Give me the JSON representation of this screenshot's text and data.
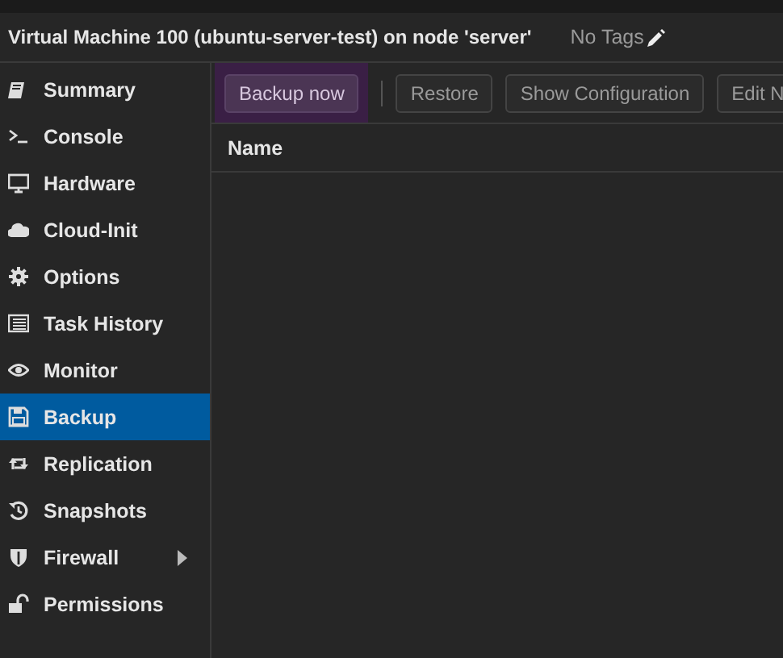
{
  "header": {
    "title": "Virtual Machine 100 (ubuntu-server-test) on node 'server'",
    "tags": "No Tags"
  },
  "sidebar": {
    "items": [
      {
        "label": "Summary",
        "kind": "book",
        "selected": false,
        "expandable": false
      },
      {
        "label": "Console",
        "kind": "terminal",
        "selected": false,
        "expandable": false
      },
      {
        "label": "Hardware",
        "kind": "monitor",
        "selected": false,
        "expandable": false
      },
      {
        "label": "Cloud-Init",
        "kind": "cloud",
        "selected": false,
        "expandable": false
      },
      {
        "label": "Options",
        "kind": "gear",
        "selected": false,
        "expandable": false
      },
      {
        "label": "Task History",
        "kind": "list",
        "selected": false,
        "expandable": false
      },
      {
        "label": "Monitor",
        "kind": "eye",
        "selected": false,
        "expandable": false
      },
      {
        "label": "Backup",
        "kind": "floppy",
        "selected": true,
        "expandable": false
      },
      {
        "label": "Replication",
        "kind": "retweet",
        "selected": false,
        "expandable": false
      },
      {
        "label": "Snapshots",
        "kind": "history",
        "selected": false,
        "expandable": false
      },
      {
        "label": "Firewall",
        "kind": "shield",
        "selected": false,
        "expandable": true
      },
      {
        "label": "Permissions",
        "kind": "unlock",
        "selected": false,
        "expandable": false
      }
    ]
  },
  "toolbar": {
    "buttons": [
      {
        "label": "Backup now",
        "focused": true,
        "disabled": false,
        "separator_after": true
      },
      {
        "label": "Restore",
        "focused": false,
        "disabled": true,
        "separator_after": false
      },
      {
        "label": "Show Configuration",
        "focused": false,
        "disabled": true,
        "separator_after": false
      },
      {
        "label": "Edit N",
        "focused": false,
        "disabled": true,
        "separator_after": false
      }
    ]
  },
  "table": {
    "columns": [
      "Name"
    ]
  }
}
